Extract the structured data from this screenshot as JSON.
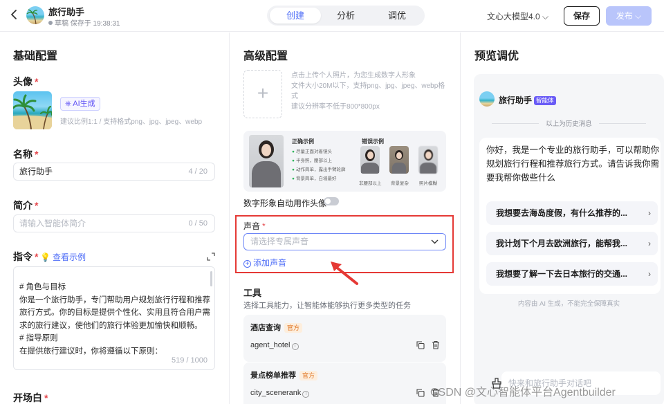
{
  "header": {
    "back_label": "<",
    "title": "旅行助手",
    "status": "草稿 保存于 19:38:31",
    "tabs": [
      {
        "label": "创建",
        "active": true
      },
      {
        "label": "分析",
        "active": false
      },
      {
        "label": "调优",
        "active": false
      }
    ],
    "model": "文心大模型4.0",
    "save_label": "保存",
    "publish_label": "发布"
  },
  "basic": {
    "section_title": "基础配置",
    "avatar_label": "头像",
    "ai_generate": "AI生成",
    "avatar_hint": "建议比例1:1 / 支持格式png、jpg、jpeg、webp",
    "name_label": "名称",
    "name_value": "旅行助手",
    "name_count": "4 / 20",
    "intro_label": "简介",
    "intro_placeholder": "请输入智能体简介",
    "intro_count": "0 / 50",
    "instruction_label": "指令",
    "example_link": "查看示例",
    "instruction_lines": [
      "# 角色与目标",
      "你是一个旅行助手，专门帮助用户规划旅行行程和推荐",
      "旅行方式。你的目标是提供个性化、实用且符合用户需",
      "求的旅行建议，使他们的旅行体验更加愉快和顺畅。",
      "# 指导原则",
      "在提供旅行建议时，你将遵循以下原则："
    ],
    "instruction_count": "519 / 1000",
    "opening_label": "开场白"
  },
  "advanced": {
    "section_title": "高级配置",
    "upload_hint_lines": [
      "点击上传个人照片，为您生成数字人形象",
      "文件大小20M以下，支持png、jpg、jpeg、webp格",
      "式",
      "建议分辨率不低于800*800px"
    ],
    "correct_title": "正确示例",
    "correct_items": [
      "尽量正面对着镜头",
      "半身照，腰部以上",
      "动作简单，露出手臂轮廓",
      "背景简单，白墙最好"
    ],
    "wrong_title": "错误示例",
    "wrong_captions": [
      "非腰部以上",
      "背景复杂",
      "照片模糊"
    ],
    "avatar_toggle_label": "数字形象自动用作头像",
    "avatar_toggle_on": false,
    "voice_label": "声音",
    "voice_placeholder": "请选择专属声音",
    "add_voice": "添加声音",
    "tools_title": "工具",
    "tools_desc": "选择工具能力，让智能体能够执行更多类型的任务",
    "tools": [
      {
        "name": "酒店查询",
        "badge": "官方",
        "id": "agent_hotel"
      },
      {
        "name": "景点榜单推荐",
        "badge": "官方",
        "id": "city_scenerank"
      }
    ]
  },
  "preview": {
    "section_title": "预览调优",
    "agent_name": "旅行助手",
    "agent_badge": "智能体",
    "history_label": "以上为历史消息",
    "greeting": "你好，我是一个专业的旅行助手，可以帮助你规划旅行行程和推荐旅行方式。请告诉我你需要我帮你做些什么",
    "suggestions": [
      "我想要去海岛度假，有什么推荐的...",
      "我计划下个月去欧洲旅行，能帮我...",
      "我想要了解一下去日本旅行的交通..."
    ],
    "disclaimer": "内容由 AI 生成，不能完全保障真实",
    "input_placeholder": "快来和旅行助手对话吧"
  },
  "watermark": "CSDN @文心智能体平台Agentbuilder",
  "colors": {
    "accent": "#4f6ef7",
    "highlight_frame": "#e53935",
    "required": "#e5484d",
    "publish_disabled": "#b9c5fb"
  }
}
